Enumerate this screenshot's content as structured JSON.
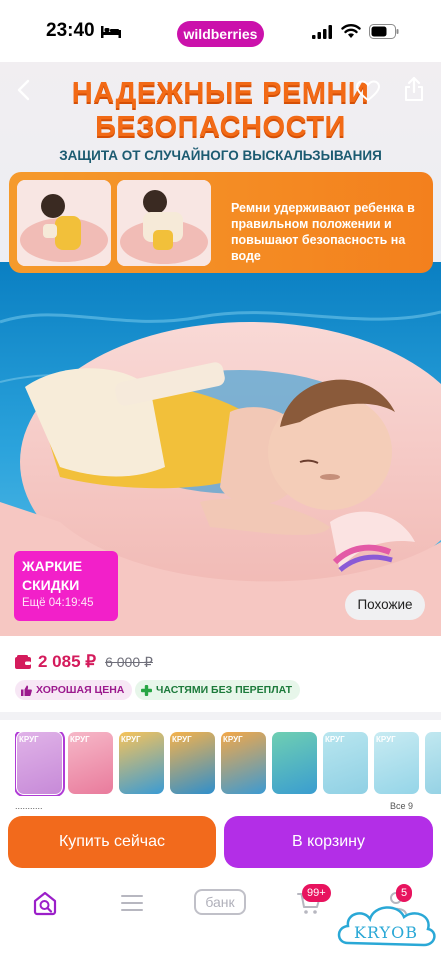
{
  "status_bar": {
    "time": "23:40",
    "app_pill": "wildberries",
    "icons": [
      "bed-icon",
      "signal-icon",
      "wifi-icon",
      "battery-icon"
    ]
  },
  "hero": {
    "title_line1": "НАДЕЖНЫЕ РЕМНИ",
    "title_line2": "БЕЗОПАСНОСТИ",
    "subtitle": "ЗАЩИТА ОТ СЛУЧАЙНОГО ВЫСКАЛЬЗЫВАНИЯ",
    "promo_text": "Ремни удерживают ребенка в правильном положении и повышают безопасность на воде",
    "sale_title": "ЖАРКИЕ СКИДКИ",
    "sale_timer": "Ещё 04:19:45",
    "similar_button": "Похожие",
    "icons": [
      "back-icon",
      "heart-icon",
      "share-icon"
    ]
  },
  "price": {
    "current": "2 085 ₽",
    "old": "6 000 ₽",
    "tags": [
      {
        "label": "ХОРОШАЯ ЦЕНА",
        "icon": "thumbs-up-icon"
      },
      {
        "label": "ЧАСТЯМИ БЕЗ ПЕРЕПЛАТ",
        "icon": "plus-icon"
      }
    ]
  },
  "variants": {
    "count": 9,
    "selected": 0,
    "label": "КРУГ",
    "strip_left": "...........",
    "strip_right": "Все 9"
  },
  "buttons": {
    "buy_now": "Купить сейчас",
    "add_to_cart": "В корзину"
  },
  "bottom_nav": {
    "items": [
      "home-search-icon",
      "menu-icon",
      "bank-icon",
      "cart-icon",
      "profile-icon"
    ],
    "bank_label": "банк",
    "cart_badge": "99+",
    "profile_badge": "5",
    "watermark_text": "KRYOB"
  },
  "colors": {
    "brand": "#cb11ab",
    "price": "#d41b5c",
    "buy": "#f26a1c",
    "cart": "#b32ee7",
    "sale_badge": "#f220c9"
  }
}
